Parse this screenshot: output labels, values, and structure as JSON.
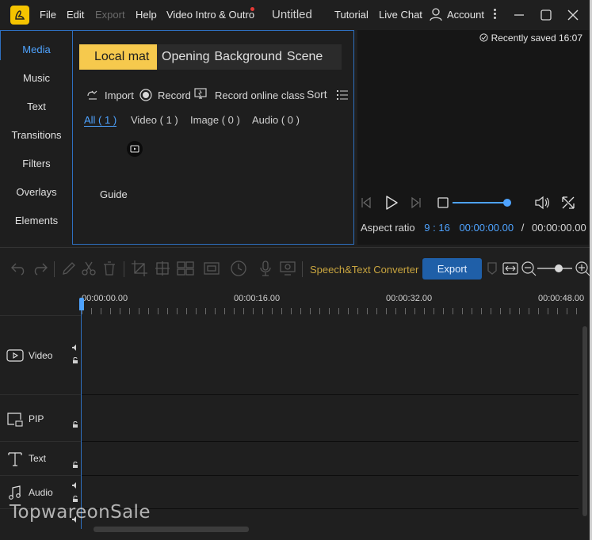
{
  "titlebar": {
    "menu": [
      {
        "label": "File",
        "enabled": true
      },
      {
        "label": "Edit",
        "enabled": true
      },
      {
        "label": "Export",
        "enabled": false
      },
      {
        "label": "Help",
        "enabled": true
      },
      {
        "label": "Video Intro & Outro",
        "enabled": true,
        "notification_dot": true
      }
    ],
    "doc_title": "Untitled",
    "tutorial": "Tutorial",
    "live_chat": "Live Chat",
    "account": "Account"
  },
  "sidebar": {
    "items": [
      "Media",
      "Music",
      "Text",
      "Transitions",
      "Filters",
      "Overlays",
      "Elements"
    ],
    "active": "Media"
  },
  "media": {
    "tabs": [
      "Local mat",
      "Opening",
      "Background",
      "Scene"
    ],
    "active_tab": "Local mat",
    "tools": {
      "import": "Import",
      "record": "Record",
      "record_online": "Record online class",
      "sort": "Sort"
    },
    "filters": [
      "All ( 1 )",
      "Video ( 1 )",
      "Image ( 0 )",
      "Audio ( 0 )"
    ],
    "active_filter": "All ( 1 )",
    "item_label": "Guide"
  },
  "preview": {
    "saved_text": "Recently saved 16:07",
    "aspect_label": "Aspect ratio",
    "aspect_value": "9 : 16",
    "current_time": "00:00:00.00",
    "separator": "/",
    "total_time": "00:00:00.00",
    "volume_level": 1.0
  },
  "toolbar": {
    "speech": "Speech&Text Converter",
    "export": "Export",
    "accent": "#1f5fa8",
    "speech_color": "#c9a53f"
  },
  "timeline": {
    "ruler": [
      "00:00:00.00",
      "00:00:16.00",
      "00:00:32.00",
      "00:00:48.00"
    ],
    "tracks": [
      {
        "label": "Video",
        "icon": "video-track-icon"
      },
      {
        "label": "PIP",
        "icon": "pip-track-icon"
      },
      {
        "label": "Text",
        "icon": "text-track-icon"
      },
      {
        "label": "Audio",
        "icon": "audio-track-icon"
      }
    ]
  },
  "watermark": "TopwareonSale"
}
